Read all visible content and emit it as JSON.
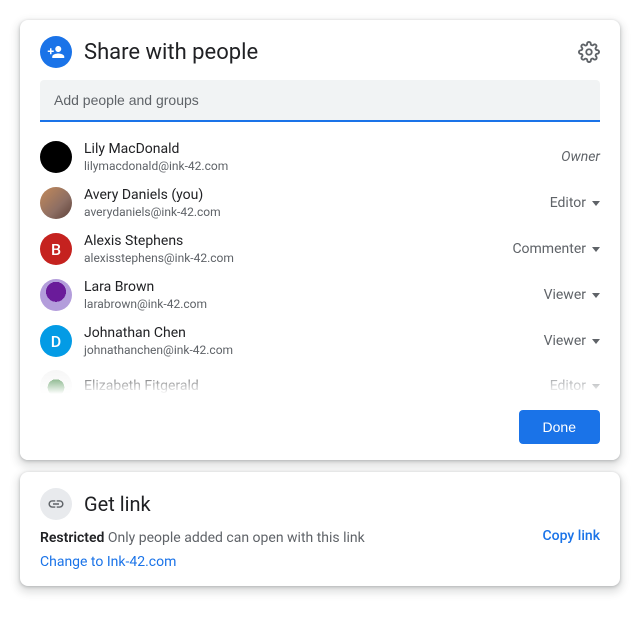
{
  "share": {
    "title": "Share with people",
    "input_placeholder": "Add people and groups",
    "done_label": "Done",
    "people": [
      {
        "name": "Lily MacDonald",
        "email": "lilymacdonald@ink-42.com",
        "role": "Owner",
        "dropdown": false,
        "avatar": "av-lily",
        "letter": ""
      },
      {
        "name": "Avery Daniels (you)",
        "email": "averydaniels@ink-42.com",
        "role": "Editor",
        "dropdown": true,
        "avatar": "av-avery",
        "letter": ""
      },
      {
        "name": "Alexis Stephens",
        "email": "alexisstephens@ink-42.com",
        "role": "Commenter",
        "dropdown": true,
        "avatar": "av-alexis",
        "letter": "B"
      },
      {
        "name": "Lara Brown",
        "email": "larabrown@ink-42.com",
        "role": "Viewer",
        "dropdown": true,
        "avatar": "av-lara",
        "letter": ""
      },
      {
        "name": "Johnathan Chen",
        "email": "johnathanchen@ink-42.com",
        "role": "Viewer",
        "dropdown": true,
        "avatar": "av-john",
        "letter": "D"
      },
      {
        "name": "Elizabeth Fitgerald",
        "email": "",
        "role": "Editor",
        "dropdown": true,
        "avatar": "av-eliza",
        "letter": ""
      }
    ]
  },
  "getlink": {
    "title": "Get link",
    "restricted_label": "Restricted",
    "restricted_desc": "Only people added can open with this link",
    "change_label": "Change to Ink-42.com",
    "copy_label": "Copy link"
  }
}
